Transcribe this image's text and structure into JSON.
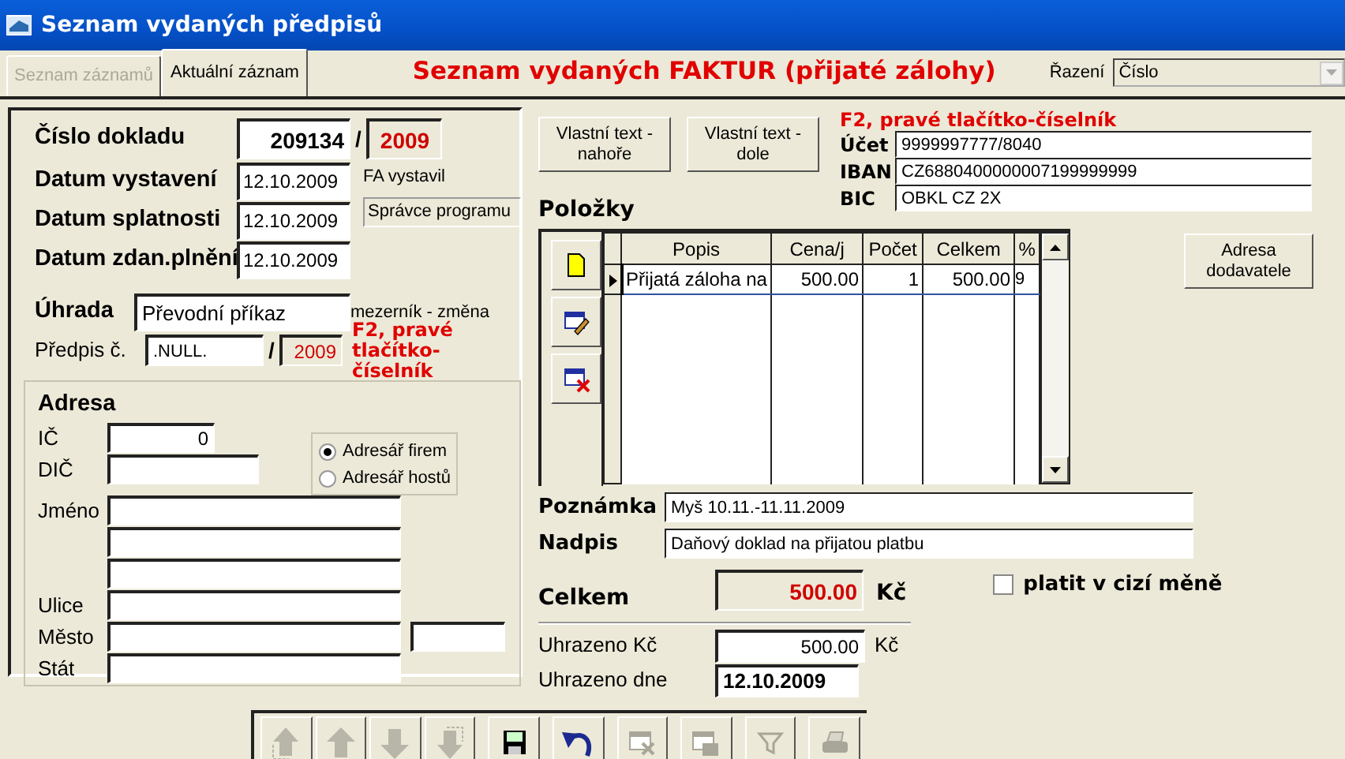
{
  "window": {
    "title": "Seznam vydaných předpisů"
  },
  "tabs": [
    {
      "label": "Seznam záznamů",
      "selected": false,
      "disabled": true
    },
    {
      "label": "Aktuální záznam",
      "selected": true,
      "disabled": false
    }
  ],
  "heading": "Seznam vydaných FAKTUR (přijaté zálohy)",
  "sort": {
    "label": "Řazení",
    "value": "Číslo",
    "disabled": true
  },
  "document": {
    "number_label": "Číslo dokladu",
    "number": "209134",
    "separator": "/",
    "year": "2009",
    "dates": [
      {
        "label": "Datum vystavení",
        "value": "12.10.2009"
      },
      {
        "label": "Datum splatnosti",
        "value": "12.10.2009"
      },
      {
        "label": "Datum zdan.plnění",
        "value": "12.10.2009"
      }
    ],
    "issued_by_label": "FA vystavil",
    "issued_by": "Správce programu",
    "payment_label": "Úhrada",
    "payment": "Převodní příkaz",
    "payment_hint": "mezerník - změna",
    "prescription_label": "Předpis č.",
    "prescription": ".NULL.",
    "prescription_separator": "/",
    "prescription_year": "2009",
    "prescription_hint": "F2, pravé tlačítko-číselník"
  },
  "address": {
    "title": "Adresa",
    "fields": [
      {
        "label": "IČ",
        "value": "0",
        "kind": "short"
      },
      {
        "label": "DIČ",
        "kind": "medium"
      },
      {
        "label": "Jméno",
        "kind": "long"
      },
      {
        "kind": "long"
      },
      {
        "kind": "long"
      },
      {
        "label": "Ulice",
        "kind": "long"
      },
      {
        "label": "Město",
        "kind": "city"
      },
      {
        "label": "Stát",
        "kind": "long"
      }
    ],
    "directory": [
      {
        "label": "Adresář firem",
        "selected": true
      },
      {
        "label": "Adresář hostů",
        "selected": false
      }
    ]
  },
  "custom_text_buttons": [
    "Vlastní text - nahoře",
    "Vlastní text - dole"
  ],
  "bank": {
    "hint": "F2, pravé tlačítko-číselník",
    "fields": [
      {
        "label": "Účet",
        "value": "9999997777/8040"
      },
      {
        "label": "IBAN",
        "value": "CZ6880400000007199999999"
      },
      {
        "label": "BIC",
        "value": "OBKL CZ 2X"
      }
    ]
  },
  "items": {
    "title": "Položky",
    "tools": [
      {
        "kind": "new"
      },
      {
        "kind": "edit"
      },
      {
        "kind": "delete"
      }
    ],
    "columns": [
      "Popis",
      "Cena/j",
      "Počet",
      "Celkem",
      "%"
    ],
    "rows": [
      {
        "selected": true,
        "cells": [
          "Přijatá záloha na",
          "500.00",
          "1",
          "500.00",
          "9"
        ]
      }
    ]
  },
  "supplier_button": "Adresa dodavatele",
  "note": {
    "label": "Poznámka",
    "value": "Myš 10.11.-11.11.2009"
  },
  "caption": {
    "label": "Nadpis",
    "value": "Daňový doklad na přijatou platbu"
  },
  "total": {
    "label": "Celkem",
    "value": "500.00",
    "currency": "Kč"
  },
  "foreign_currency": {
    "label": "platit v cizí měně",
    "checked": false
  },
  "paid": [
    {
      "label": "Uhrazeno Kč",
      "value": "500.00",
      "currency": "Kč",
      "kind": "amount"
    },
    {
      "label": "Uhrazeno dne",
      "value": "12.10.2009",
      "kind": "date"
    }
  ],
  "toolbar": [
    {
      "kind": "first",
      "disabled": true
    },
    {
      "kind": "prev",
      "disabled": true
    },
    {
      "kind": "next",
      "disabled": true
    },
    {
      "kind": "last",
      "disabled": true
    },
    {
      "kind": "save",
      "disabled": false
    },
    {
      "kind": "undo",
      "disabled": false
    },
    {
      "kind": "delete",
      "disabled": true
    },
    {
      "kind": "copy",
      "disabled": true
    },
    {
      "kind": "filter",
      "disabled": true
    },
    {
      "kind": "print",
      "disabled": true
    }
  ]
}
